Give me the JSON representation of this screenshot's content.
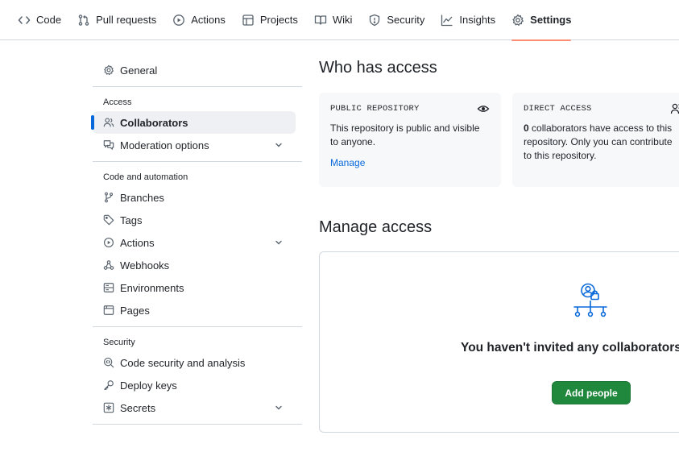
{
  "repo_nav": {
    "items": [
      {
        "label": "Code",
        "icon": "code-icon"
      },
      {
        "label": "Pull requests",
        "icon": "pull-request-icon"
      },
      {
        "label": "Actions",
        "icon": "play-icon"
      },
      {
        "label": "Projects",
        "icon": "table-icon"
      },
      {
        "label": "Wiki",
        "icon": "book-icon"
      },
      {
        "label": "Security",
        "icon": "shield-icon"
      },
      {
        "label": "Insights",
        "icon": "graph-icon"
      },
      {
        "label": "Settings",
        "icon": "gear-icon",
        "active": true
      }
    ],
    "active_underline_color": "#fd8c73"
  },
  "sidebar": {
    "general": "General",
    "sections": {
      "access": {
        "heading": "Access",
        "items": [
          "Collaborators",
          "Moderation options"
        ]
      },
      "code_automation": {
        "heading": "Code and automation",
        "items": [
          "Branches",
          "Tags",
          "Actions",
          "Webhooks",
          "Environments",
          "Pages"
        ]
      },
      "security": {
        "heading": "Security",
        "items": [
          "Code security and analysis",
          "Deploy keys",
          "Secrets"
        ]
      }
    },
    "selected": "Collaborators",
    "selected_indicator_color": "#0969da"
  },
  "who_has_access": {
    "title": "Who has access",
    "public_card": {
      "label": "PUBLIC REPOSITORY",
      "text": "This repository is public and visible to anyone.",
      "link": "Manage"
    },
    "direct_card": {
      "label": "DIRECT ACCESS",
      "count": "0",
      "text": " collaborators have access to this repository. Only you can contribute to this repository."
    }
  },
  "manage_access": {
    "title": "Manage access",
    "empty_message": "You haven't invited any collaborators yet",
    "button": "Add people",
    "button_color": "#1f883d"
  }
}
